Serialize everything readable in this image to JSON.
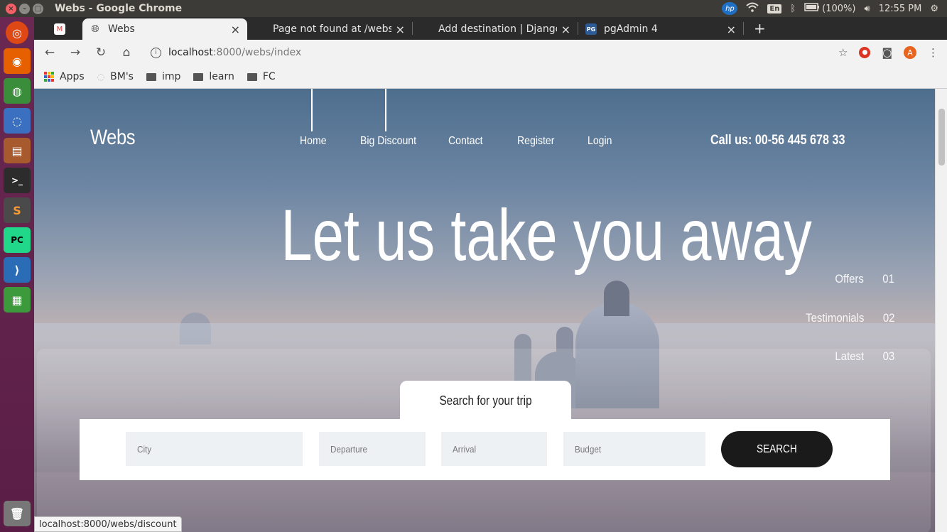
{
  "os": {
    "window_title": "Webs - Google Chrome",
    "battery": "(100%)",
    "time": "12:55 PM",
    "keyboard_layout": "En",
    "launcher_icons": [
      "ubuntu-icon",
      "firefox-icon",
      "chrome-icon",
      "chromium-icon",
      "files-icon",
      "terminal-icon",
      "sublime-icon",
      "pycharm-icon",
      "vscode-icon",
      "spreadsheet-icon",
      "trash-icon"
    ]
  },
  "browser": {
    "tabs": [
      {
        "title": "",
        "favicon": "gmail-icon",
        "active": false
      },
      {
        "title": "Webs",
        "favicon": "globe-icon",
        "active": true
      },
      {
        "title": "Page not found at /webs/",
        "favicon": "blank-icon",
        "active": false
      },
      {
        "title": "Add destination | Django",
        "favicon": "blank-icon",
        "active": false
      },
      {
        "title": "pgAdmin 4",
        "favicon": "pg-icon",
        "active": false
      }
    ],
    "address": {
      "host": "localhost",
      "path": ":8000/webs/index"
    },
    "bookmarks": [
      {
        "label": "Apps",
        "icon": "apps-grid-icon"
      },
      {
        "label": "BM's",
        "icon": "bookmark-icon"
      },
      {
        "label": "imp",
        "icon": "folder-icon"
      },
      {
        "label": "learn",
        "icon": "folder-icon"
      },
      {
        "label": "FC",
        "icon": "folder-icon"
      }
    ],
    "avatar_letter": "A",
    "status_url": "localhost:8000/webs/discount"
  },
  "site": {
    "logo": "Webs",
    "nav": [
      "Home",
      "Big Discount",
      "Contact",
      "Register",
      "Login"
    ],
    "call_us": "Call us: 00-56 445 678 33",
    "hero_title": "Let us take you away",
    "side_menu": [
      {
        "label": "Offers",
        "num": "01"
      },
      {
        "label": "Testimonials",
        "num": "02"
      },
      {
        "label": "Latest",
        "num": "03"
      }
    ],
    "search": {
      "tab_label": "Search for your trip",
      "fields": [
        "City",
        "Departure",
        "Arrival",
        "Budget"
      ],
      "button": "SEARCH"
    }
  }
}
